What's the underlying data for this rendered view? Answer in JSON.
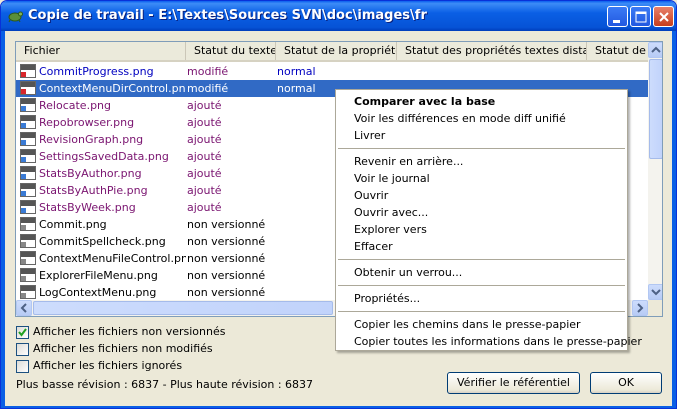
{
  "window": {
    "title": "Copie de travail - E:\\Textes\\Sources SVN\\doc\\images\\fr"
  },
  "columns": [
    "Fichier",
    "Statut du texte",
    "Statut de la propriété",
    "Statut des propriétés textes distantes",
    "Statut de l"
  ],
  "files": [
    {
      "name": "CommitProgress.png",
      "status": "modifié",
      "prop": "normal",
      "kind": "mod"
    },
    {
      "name": "ContextMenuDirControl.png",
      "status": "modifié",
      "prop": "normal",
      "kind": "mod",
      "selected": true
    },
    {
      "name": "Relocate.png",
      "status": "ajouté",
      "prop": "",
      "kind": "add"
    },
    {
      "name": "Repobrowser.png",
      "status": "ajouté",
      "prop": "",
      "kind": "add"
    },
    {
      "name": "RevisionGraph.png",
      "status": "ajouté",
      "prop": "",
      "kind": "add"
    },
    {
      "name": "SettingsSavedData.png",
      "status": "ajouté",
      "prop": "",
      "kind": "add"
    },
    {
      "name": "StatsByAuthor.png",
      "status": "ajouté",
      "prop": "",
      "kind": "add"
    },
    {
      "name": "StatsByAuthPie.png",
      "status": "ajouté",
      "prop": "",
      "kind": "add"
    },
    {
      "name": "StatsByWeek.png",
      "status": "ajouté",
      "prop": "",
      "kind": "add"
    },
    {
      "name": "Commit.png",
      "status": "non versionné",
      "prop": "",
      "kind": "nv"
    },
    {
      "name": "CommitSpellcheck.png",
      "status": "non versionné",
      "prop": "",
      "kind": "nv"
    },
    {
      "name": "ContextMenuFileControl.png",
      "status": "non versionné",
      "prop": "",
      "kind": "nv"
    },
    {
      "name": "ExplorerFileMenu.png",
      "status": "non versionné",
      "prop": "",
      "kind": "nv"
    },
    {
      "name": "LogContextMenu.png",
      "status": "non versionné",
      "prop": "",
      "kind": "nv"
    }
  ],
  "context_menu": {
    "items": [
      {
        "label": "Comparer avec la base",
        "bold": true
      },
      {
        "label": "Voir les différences en mode diff unifié"
      },
      {
        "label": "Livrer"
      },
      {
        "sep": true
      },
      {
        "label": "Revenir en arrière..."
      },
      {
        "label": "Voir le journal"
      },
      {
        "label": "Ouvrir"
      },
      {
        "label": "Ouvrir avec..."
      },
      {
        "label": "Explorer vers"
      },
      {
        "label": "Effacer"
      },
      {
        "sep": true
      },
      {
        "label": "Obtenir un verrou..."
      },
      {
        "sep": true
      },
      {
        "label": "Propriétés..."
      },
      {
        "sep": true
      },
      {
        "label": "Copier les chemins dans le presse-papier"
      },
      {
        "label": "Copier toutes les informations dans le presse-papier"
      }
    ]
  },
  "options": {
    "show_unversioned": {
      "label": "Afficher les fichiers non versionnés",
      "checked": true
    },
    "show_unmodified": {
      "label": "Afficher les fichiers non modifiés",
      "checked": false
    },
    "show_ignored": {
      "label": "Afficher les fichiers ignorés",
      "checked": false
    }
  },
  "revision_info": "Plus basse révision : 6837 - Plus haute révision : 6837",
  "buttons": {
    "check_repo": "Vérifier le référentiel",
    "ok": "OK"
  },
  "colors": {
    "titlebar": "#0a5fe5",
    "selection": "#316ac5",
    "modified_name": "#0000c0",
    "added": "#7a1470"
  }
}
